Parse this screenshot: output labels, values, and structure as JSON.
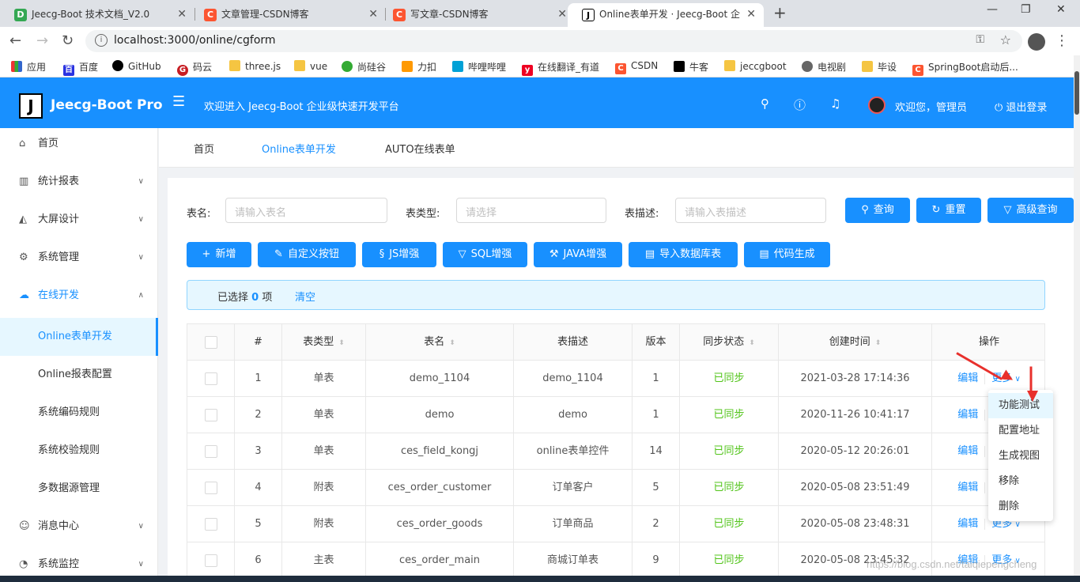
{
  "browser": {
    "tabs": [
      {
        "title": "Jeecg-Boot 技术文档_V2.0",
        "favicon": "doc-icon",
        "color": "#34a853"
      },
      {
        "title": "文章管理-CSDN博客",
        "favicon": "csdn-icon",
        "color": "#fc5531"
      },
      {
        "title": "写文章-CSDN博客",
        "favicon": "csdn-icon",
        "color": "#fc5531"
      },
      {
        "title": "Online表单开发 · Jeecg-Boot 企",
        "favicon": "jeecg-icon",
        "color": "#000000"
      }
    ],
    "url": "localhost:3000/online/cgform",
    "bookmarks": [
      "应用",
      "百度",
      "GitHub",
      "码云",
      "three.js",
      "vue",
      "尚硅谷",
      "力扣",
      "哔哩哔哩",
      "在线翻译_有道",
      "CSDN",
      "牛客",
      "jeccgboot",
      "电视剧",
      "毕设",
      "SpringBoot启动后..."
    ]
  },
  "header": {
    "logo_letter": "J",
    "title": "Jeecg-Boot Pro",
    "welcome": "欢迎进入 Jeecg-Boot 企业级快速开发平台",
    "user": "欢迎您，管理员",
    "logout": "退出登录",
    "brand_color": "#1890ff"
  },
  "sidebar": {
    "items": [
      {
        "label": "首页",
        "icon": "home-icon"
      },
      {
        "label": "统计报表",
        "icon": "bar-chart-icon"
      },
      {
        "label": "大屏设计",
        "icon": "area-chart-icon"
      },
      {
        "label": "系统管理",
        "icon": "gear-icon"
      },
      {
        "label": "在线开发",
        "icon": "cloud-icon"
      }
    ],
    "subitems": [
      "Online表单开发",
      "Online报表配置",
      "系统编码规则",
      "系统校验规则",
      "多数据源管理"
    ],
    "bottom_items": [
      {
        "label": "消息中心",
        "icon": "message-icon"
      },
      {
        "label": "系统监控",
        "icon": "dashboard-icon"
      }
    ]
  },
  "page_tabs": [
    "首页",
    "Online表单开发",
    "AUTO在线表单"
  ],
  "search": {
    "table_name_label": "表名:",
    "table_name_placeholder": "请输入表名",
    "table_type_label": "表类型:",
    "table_type_placeholder": "请选择",
    "table_desc_label": "表描述:",
    "table_desc_placeholder": "请输入表描述",
    "query": "查询",
    "reset": "重置",
    "advanced": "高级查询"
  },
  "toolbar": {
    "add": "新增",
    "custom_button": "自定义按钮",
    "js": "JS增强",
    "sql": "SQL增强",
    "java": "JAVA增强",
    "import_db": "导入数据库表",
    "codegen": "代码生成"
  },
  "selection": {
    "prefix": "已选择",
    "count": "0",
    "suffix": "项",
    "clear": "清空"
  },
  "table": {
    "headers": [
      "#",
      "表类型",
      "表名",
      "表描述",
      "版本",
      "同步状态",
      "创建时间",
      "操作"
    ],
    "rows": [
      {
        "no": "1",
        "type": "单表",
        "name": "demo_1104",
        "desc": "demo_1104",
        "version": "1",
        "sync": "已同步",
        "created": "2021-03-28 17:14:36"
      },
      {
        "no": "2",
        "type": "单表",
        "name": "demo",
        "desc": "demo",
        "version": "1",
        "sync": "已同步",
        "created": "2020-11-26 10:41:17"
      },
      {
        "no": "3",
        "type": "单表",
        "name": "ces_field_kongj",
        "desc": "online表单控件",
        "version": "14",
        "sync": "已同步",
        "created": "2020-05-12 20:26:01"
      },
      {
        "no": "4",
        "type": "附表",
        "name": "ces_order_customer",
        "desc": "订单客户",
        "version": "5",
        "sync": "已同步",
        "created": "2020-05-08 23:51:49"
      },
      {
        "no": "5",
        "type": "附表",
        "name": "ces_order_goods",
        "desc": "订单商品",
        "version": "2",
        "sync": "已同步",
        "created": "2020-05-08 23:48:31"
      },
      {
        "no": "6",
        "type": "主表",
        "name": "ces_order_main",
        "desc": "商城订单表",
        "version": "9",
        "sync": "已同步",
        "created": "2020-05-08 23:45:32"
      }
    ],
    "edit": "编辑",
    "more": "更多"
  },
  "dropdown": [
    "功能测试",
    "配置地址",
    "生成视图",
    "移除",
    "删除"
  ],
  "watermark": "https://blog.csdn.net/taiqiepengcheng"
}
